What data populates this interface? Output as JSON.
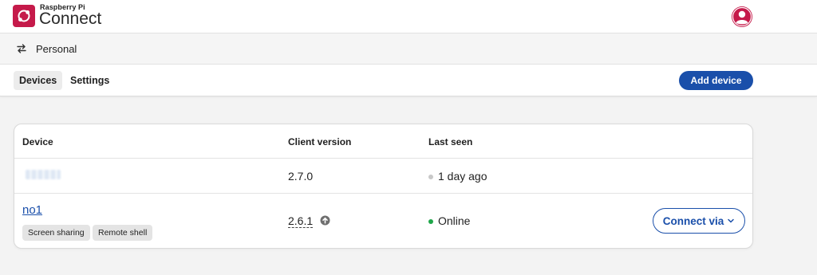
{
  "header": {
    "brand_small": "Raspberry Pi",
    "brand_big": "Connect",
    "logo_icon": "raspberry-pi-connect-logo",
    "avatar_icon": "user-avatar-icon",
    "brand_color": "#c51a4a"
  },
  "workspace": {
    "icon": "swap-arrows-icon",
    "label": "Personal"
  },
  "tabs": [
    {
      "label": "Devices",
      "active": true
    },
    {
      "label": "Settings",
      "active": false
    }
  ],
  "toolbar": {
    "add_device_label": "Add device",
    "accent_color": "#1a4faa"
  },
  "table": {
    "headers": [
      "Device",
      "Client version",
      "Last seen"
    ],
    "rows": [
      {
        "device": "",
        "client_version": "2.7.0",
        "last_seen": "1 day ago",
        "status_color": "#c8c8c8"
      },
      {
        "device": "no1",
        "tags": [
          "Screen sharing",
          "Remote shell"
        ],
        "client_version": "2.6.1",
        "update_icon": "update-available-icon",
        "last_seen": "Online",
        "status_color": "#1fa64a",
        "action_label": "Connect via"
      }
    ]
  }
}
